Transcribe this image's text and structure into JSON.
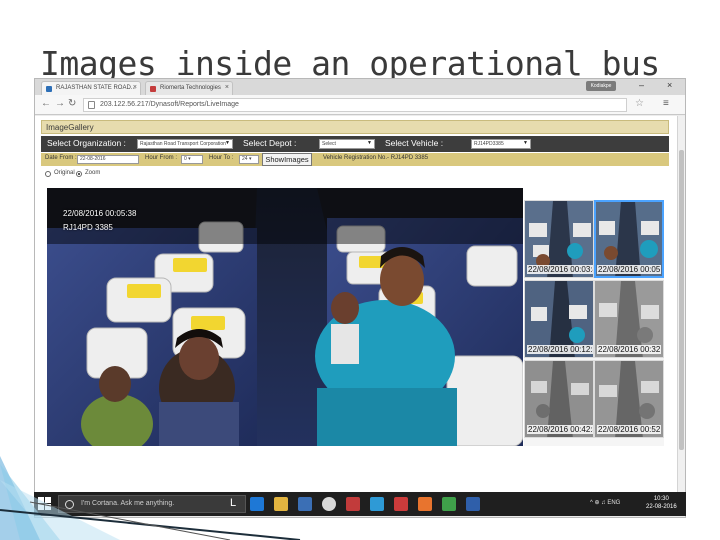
{
  "slide": {
    "title": "Images inside an operational bus"
  },
  "browser": {
    "tabs": [
      {
        "label": "RAJASTHAN STATE ROAD...",
        "close": "×"
      },
      {
        "label": "Riomerta Technologies",
        "close": "×"
      }
    ],
    "profile_badge": "Kodiakpe",
    "window_controls": {
      "minimize": "–",
      "close": "×"
    },
    "url": "203.122.56.217/Dynasoft/Reports/LiveImage"
  },
  "gallery": {
    "header": "ImageGallery",
    "filters": {
      "org_label": "Select Organization :",
      "org_value": "Rajasthan Road Transport Corporation",
      "depot_label": "Select Depot :",
      "depot_value": "Select",
      "vehicle_label": "Select Vehicle :",
      "vehicle_value": "RJ14PD3385"
    },
    "row2": {
      "date_from_label": "Date From :",
      "date_from_value": "22-08-2016",
      "hour_from_label": "Hour From :",
      "hour_from_value": "0",
      "hour_to_label": "Hour To :",
      "hour_to_value": "24",
      "show_button": "ShowImages",
      "vehicle_registration": "Vehicle Registration No.- RJ14PD 3385"
    },
    "view_options": [
      {
        "label": "Original",
        "selected": false
      },
      {
        "label": "Zoom",
        "selected": true
      }
    ],
    "main_image": {
      "timestamp": "22/08/2016 00:05:38",
      "vehicle": "RJ14PD 3385"
    },
    "thumbnails": [
      {
        "timestamp": "22/08/2016 00:03:48",
        "selected": false
      },
      {
        "timestamp": "22/08/2016 00:05",
        "selected": true
      },
      {
        "timestamp": "22/08/2016 00:12:50",
        "selected": false
      },
      {
        "timestamp": "22/08/2016 00:32",
        "selected": false
      },
      {
        "timestamp": "22/08/2016 00:42:35",
        "selected": false
      },
      {
        "timestamp": "22/08/2016 00:52",
        "selected": false
      }
    ]
  },
  "taskbar": {
    "cortana_placeholder": "I'm Cortana. Ask me anything.",
    "task_view_icon": "L",
    "tray_text": "^ ⊕ ♫ ENG",
    "clock_time": "10:30",
    "clock_date": "22-08-2016"
  },
  "colors": {
    "gallery_header": "#e7dcae",
    "filter_bar_dark": "#3d3d3d",
    "filter_bar_gold": "#d9c87e",
    "seat_blue": "#2d3a63",
    "thumb_selected": "#4ba3ff",
    "taskbar": "#1f1f1f"
  }
}
